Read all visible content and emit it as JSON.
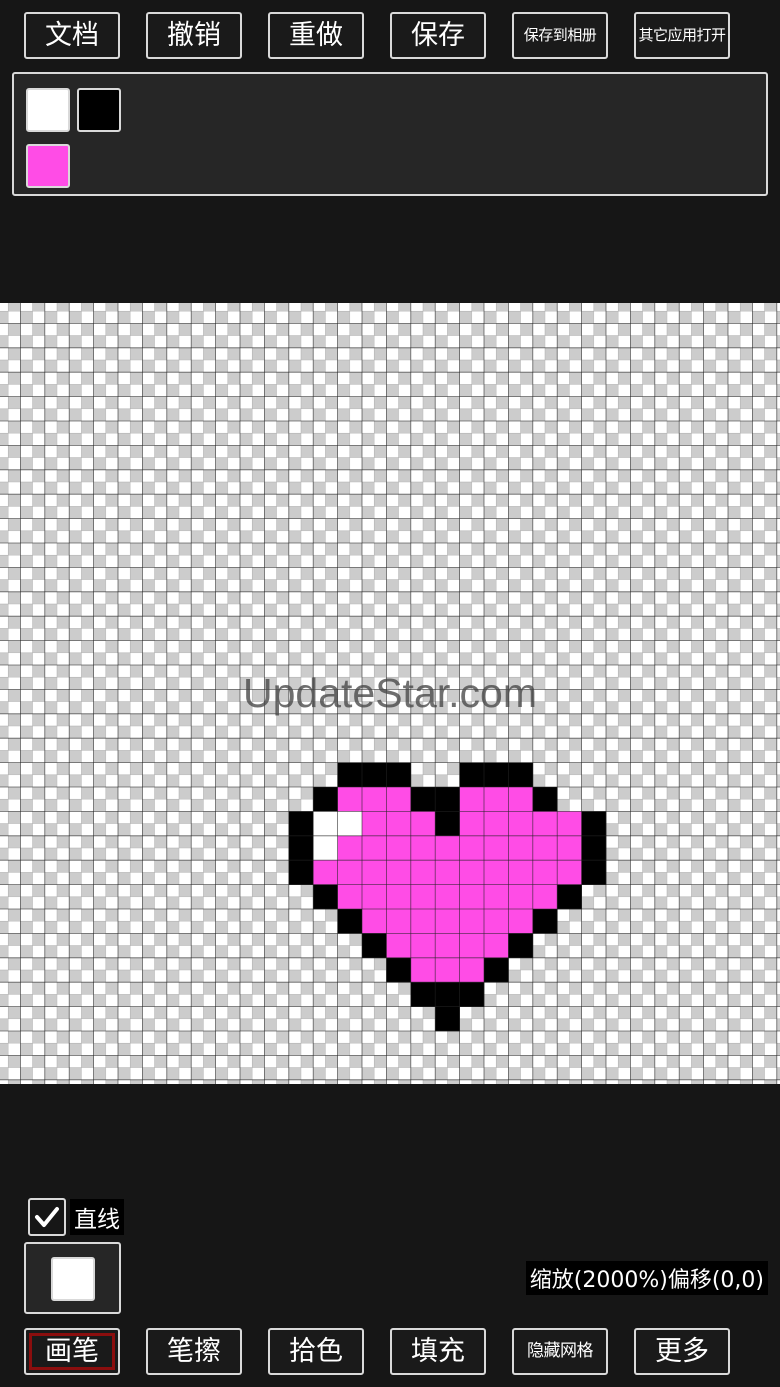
{
  "toolbar_top": {
    "file_label": "文档",
    "undo_label": "撤销",
    "redo_label": "重做",
    "save_label": "保存",
    "save_album_label": "保存到相册",
    "open_other_label": "其它应用打开"
  },
  "palette": {
    "colors": [
      "#ffffff",
      "#000000",
      "#ff4ce6"
    ]
  },
  "canvas": {
    "watermark": "UpdateStar.com",
    "pixel_colors": {
      "B": "#000000",
      "P": "#ff4ce6",
      "W": "#ffffff"
    },
    "pixel_rows": [
      ".....BBB..BBB....",
      "....BPPPBBPPPB...",
      "...BWWPPPBPPPPPB.",
      "...BWPPPPPPPPPPB.",
      "...BPPPPPPPPPPPB.",
      "....BPPPPPPPPPB..",
      ".....BPPPPPPPB...",
      "......BPPPPPB....",
      ".......BPPPB.....",
      "........BBB......",
      ".........B......."
    ]
  },
  "options": {
    "line_label": "直线",
    "line_checked": true
  },
  "current_color": "#ffffff",
  "status": {
    "zoom_text": "缩放(2000%)偏移(0,0)"
  },
  "toolbar_bottom": {
    "brush_label": "画笔",
    "eraser_label": "笔擦",
    "picker_label": "拾色",
    "fill_label": "填充",
    "hide_grid_label": "隐藏网格",
    "more_label": "更多"
  }
}
